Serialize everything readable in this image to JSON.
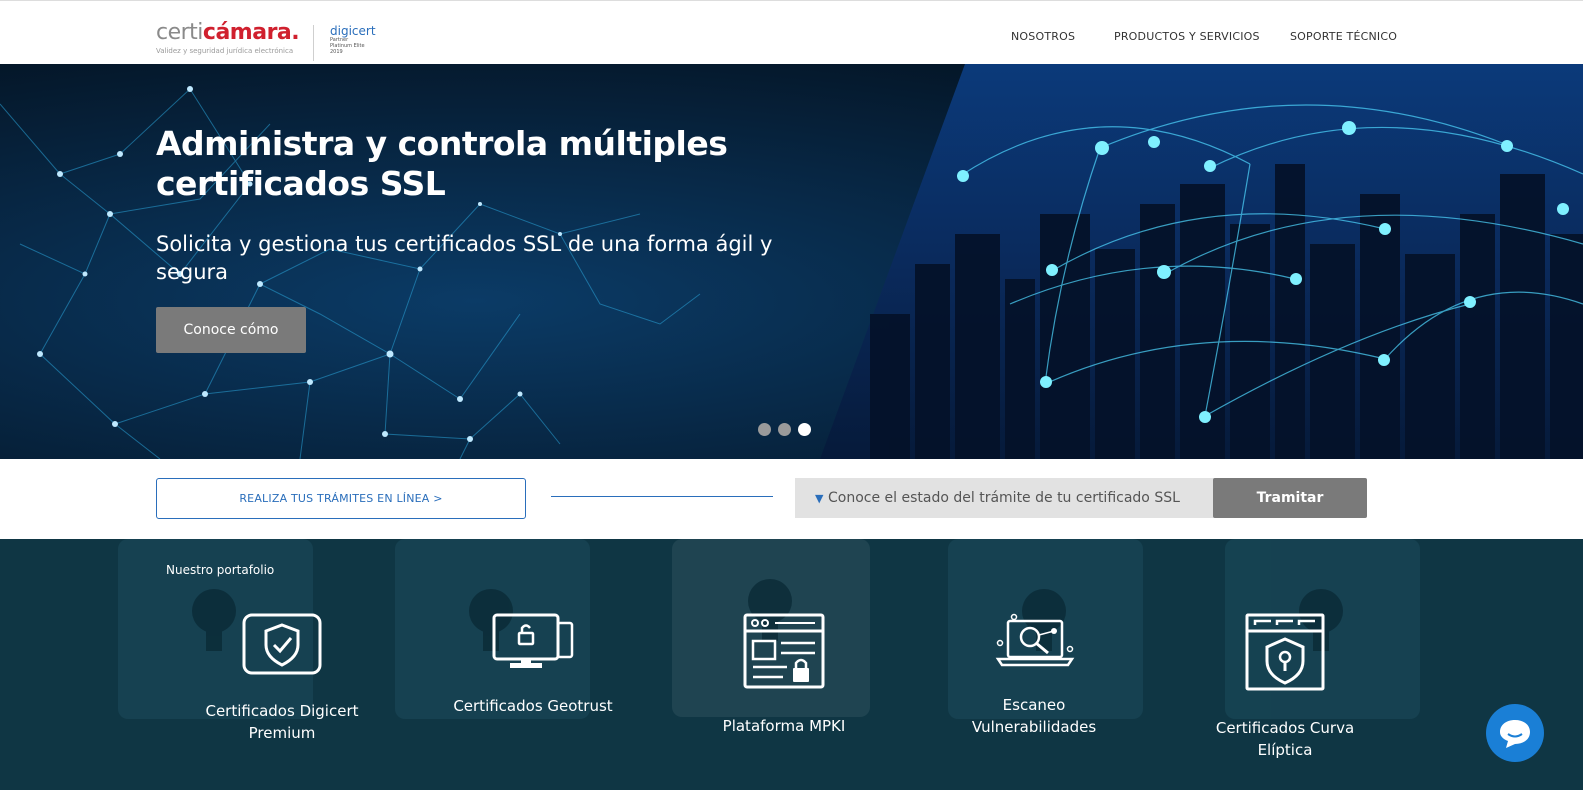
{
  "header": {
    "logo_certi": "certi",
    "logo_camara": "cámara.",
    "logo_tagline": "Validez y seguridad jurídica electrónica",
    "partner_name": "digicert",
    "partner_line1": "Partner",
    "partner_line2": "Platinum Elite",
    "partner_line3": "2019",
    "nav": [
      "NOSOTROS",
      "PRODUCTOS Y SERVICIOS",
      "SOPORTE TÉCNICO"
    ]
  },
  "hero": {
    "title": "Administra y controla múltiples certificados SSL",
    "subtitle": "Solicita y gestiona tus certificados SSL de una forma ágil y segura",
    "button_label": "Conoce cómo",
    "slides": 3,
    "active_slide": 3
  },
  "actions": {
    "tramites_label": "REALIZA TUS TRÁMITES EN LÍNEA >",
    "status_select": "Conoce el estado del trámite de tu certificado SSL",
    "tramitar_label": "Tramitar"
  },
  "portfolio": {
    "title": "Nuestro portafolio",
    "items": [
      {
        "label": "Certificados Digicert Premium",
        "icon": "shield-check-icon"
      },
      {
        "label": "Certificados Geotrust",
        "icon": "monitor-lock-icon"
      },
      {
        "label": "Plataforma MPKI",
        "icon": "browser-lock-icon"
      },
      {
        "label": "Escaneo Vulnerabilidades",
        "icon": "laptop-scan-icon"
      },
      {
        "label": "Certificados Curva Elíptica",
        "icon": "window-shield-icon"
      }
    ]
  },
  "colors": {
    "brand_red": "#d0202e",
    "link_blue": "#2a6ebb",
    "button_gray": "#7a7a7a",
    "hero_dark": "#051a2e",
    "portfolio_bg": "#0f3644",
    "chat_blue": "#1a7fd6"
  }
}
